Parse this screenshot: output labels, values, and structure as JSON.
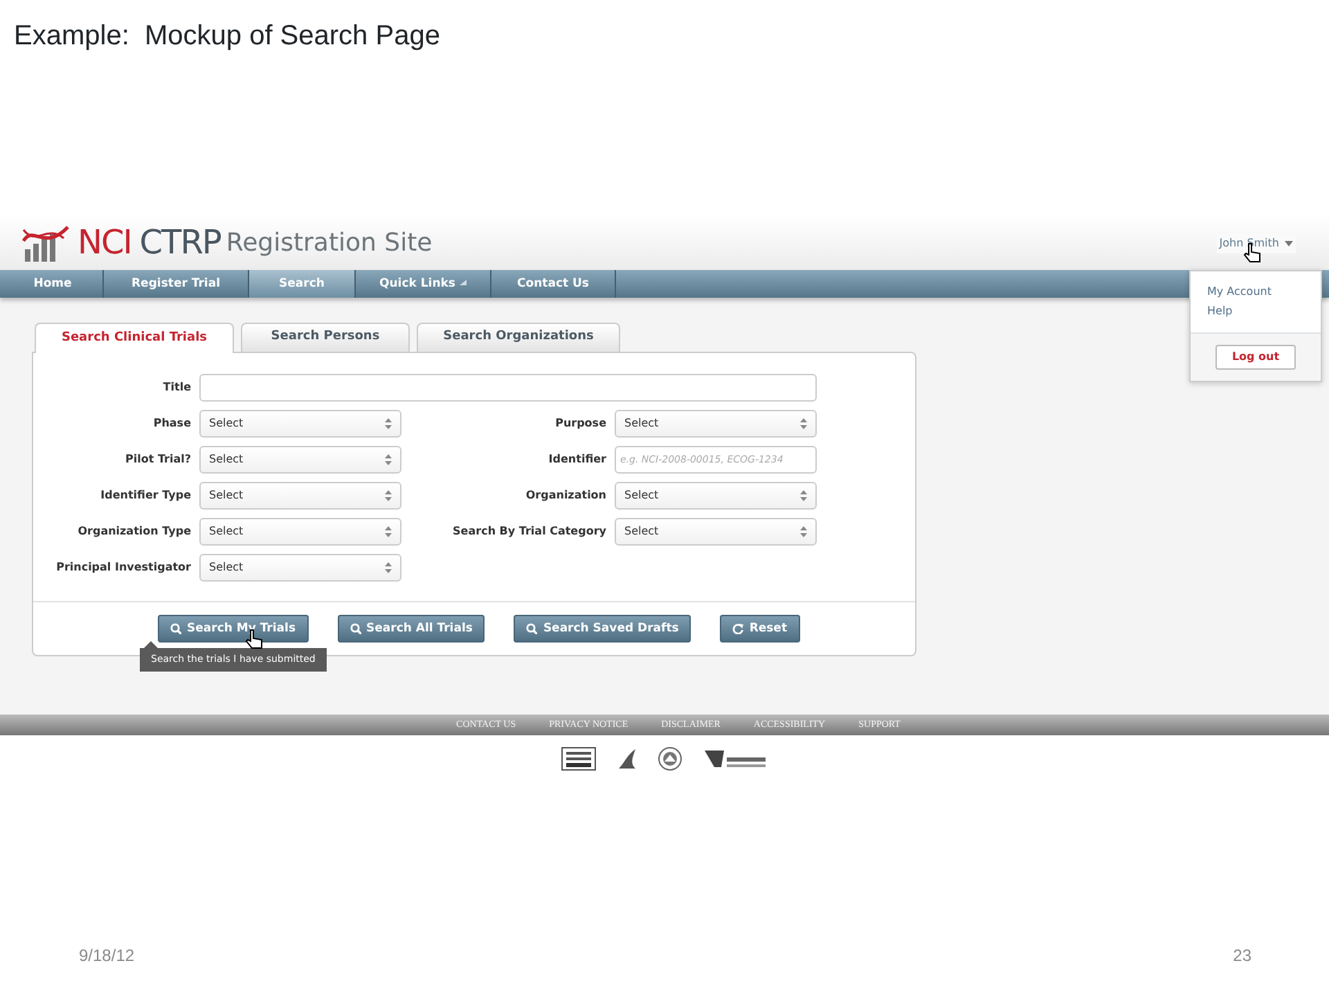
{
  "slide": {
    "title": "Example:  Mockup of Search Page",
    "date": "9/18/12",
    "page_number": "23"
  },
  "header": {
    "brand": [
      {
        "kind": "acronym",
        "text": "NCI"
      },
      {
        "kind": "product",
        "text": "CTRP"
      },
      {
        "kind": "subtitle",
        "text": "Registration Site"
      }
    ],
    "user_menu": {
      "name": "John Smith",
      "expanded": true,
      "items": [
        "My Account",
        "Help"
      ],
      "logout": "Log out"
    }
  },
  "nav": [
    {
      "label": "Home",
      "selected": false,
      "dropdown": false
    },
    {
      "label": "Register Trial",
      "selected": false,
      "dropdown": false
    },
    {
      "label": "Search",
      "selected": true,
      "dropdown": false
    },
    {
      "label": "Quick Links",
      "selected": false,
      "dropdown": true
    },
    {
      "label": "Contact Us",
      "selected": false,
      "dropdown": false
    }
  ],
  "tabs": [
    {
      "label": "Search Clinical Trials",
      "selected": true
    },
    {
      "label": "Search Persons",
      "selected": false
    },
    {
      "label": "Search Organizations",
      "selected": false
    }
  ],
  "form": {
    "title": {
      "label": "Title",
      "kind": "text"
    },
    "left": [
      {
        "label": "Phase",
        "kind": "select",
        "value": "Select"
      },
      {
        "label": "Pilot Trial?",
        "kind": "select",
        "value": "Select"
      },
      {
        "label": "Identifier Type",
        "kind": "select",
        "value": "Select"
      },
      {
        "label": "Organization Type",
        "kind": "select",
        "value": "Select"
      },
      {
        "label": "Principal Investigator",
        "kind": "select",
        "value": "Select"
      }
    ],
    "right": [
      {
        "label": "Purpose",
        "kind": "select",
        "value": "Select"
      },
      {
        "label": "Identifier",
        "kind": "text",
        "placeholder": "e.g. NCI-2008-00015, ECOG-1234"
      },
      {
        "label": "Organization",
        "kind": "select",
        "value": "Select"
      },
      {
        "label": "Search By Trial Category",
        "kind": "select",
        "value": "Select"
      }
    ]
  },
  "buttons": [
    {
      "label": "Search My Trials",
      "kind": "search",
      "tooltip": "Search the trials I have submitted"
    },
    {
      "label": "Search All Trials",
      "kind": "search"
    },
    {
      "label": "Search Saved Drafts",
      "kind": "search"
    },
    {
      "label": "Reset",
      "kind": "reset"
    }
  ],
  "footer_links": [
    "CONTACT US",
    "PRIVACY NOTICE",
    "DISCLAIMER",
    "ACCESSIBILITY",
    "SUPPORT"
  ]
}
